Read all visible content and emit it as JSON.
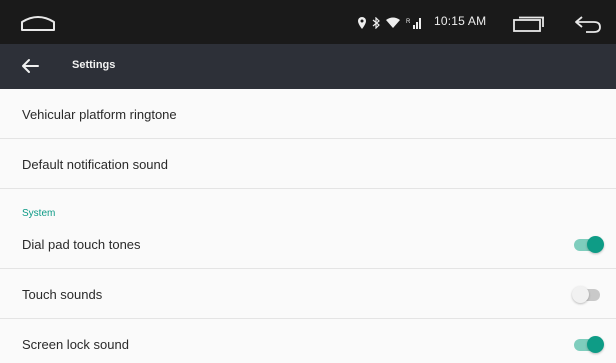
{
  "status_bar": {
    "time": "10:15 AM",
    "icons": [
      "home-icon",
      "location-icon",
      "bluetooth-icon",
      "wifi-icon",
      "signal-icon",
      "recents-icon",
      "back-arrow-icon"
    ]
  },
  "toolbar": {
    "back_icon": "arrow-left-icon",
    "title": "Settings"
  },
  "rows": {
    "vehicular_ringtone": {
      "label": "Vehicular platform ringtone"
    },
    "default_notification": {
      "label": "Default notification sound"
    }
  },
  "section": {
    "label": "System"
  },
  "toggles": {
    "dial_pad": {
      "label": "Dial pad touch tones",
      "on": true
    },
    "touch_sounds": {
      "label": "Touch sounds",
      "on": false
    },
    "screen_lock": {
      "label": "Screen lock sound",
      "on": true
    }
  },
  "colors": {
    "accent": "#0e9c86",
    "accent_track": "#7fcdbd",
    "toolbar": "#2d3038",
    "status_bar": "#1a1a1a",
    "background": "#fafafa"
  }
}
